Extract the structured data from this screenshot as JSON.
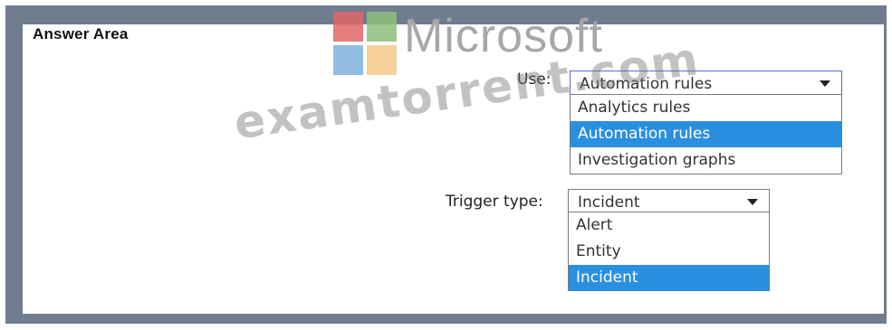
{
  "answer_area": {
    "title": "Answer Area"
  },
  "watermark": {
    "brand": "Microsoft",
    "site": "examtorrent.com",
    "logo_colors": [
      "#e06666",
      "#8dc07a",
      "#7fb0de",
      "#f6c98a"
    ]
  },
  "use": {
    "label": "Use:",
    "selected": "Automation rules",
    "options": [
      "Analytics rules",
      "Automation rules",
      "Investigation graphs"
    ],
    "highlighted_index": 1
  },
  "trigger": {
    "label": "Trigger type:",
    "selected": "Incident",
    "options": [
      "Alert",
      "Entity",
      "Incident"
    ],
    "highlighted_index": 2
  },
  "colors": {
    "frame": "#6f7d8e",
    "highlight": "#2b8fe0"
  }
}
